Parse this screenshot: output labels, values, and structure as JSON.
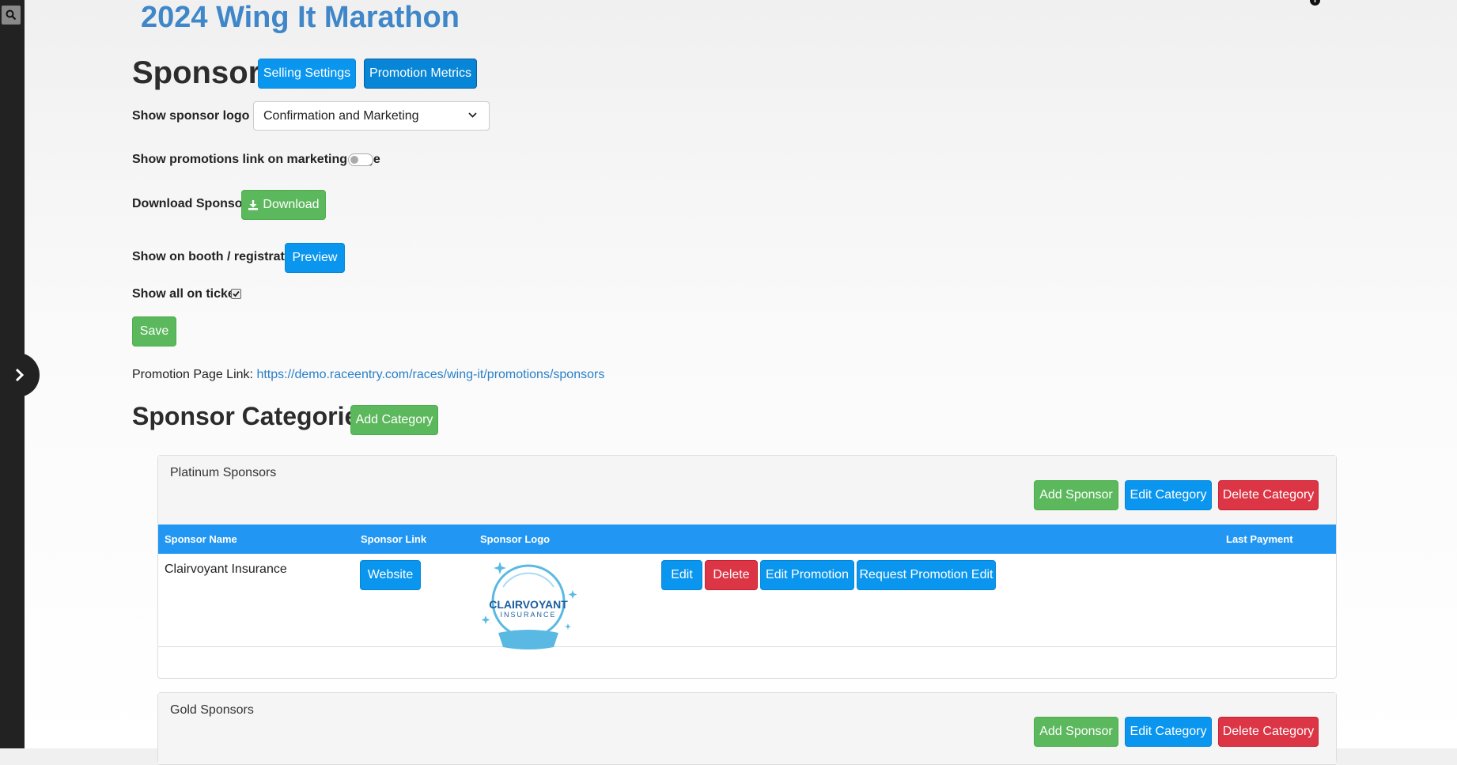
{
  "event_title": "2024 Wing It Marathon",
  "page_title": "Sponsors",
  "header_buttons": {
    "selling_settings": "Selling Settings",
    "promotion_metrics": "Promotion Metrics"
  },
  "settings": {
    "show_logo_label": "Show sponsor logo on",
    "show_logo_value": "Confirmation and Marketing",
    "show_promotions_label": "Show promotions link on marketing page",
    "show_promotions_enabled": false,
    "download_label": "Download Sponsors",
    "download_button": "Download",
    "booth_label": "Show on booth / registration",
    "preview_button": "Preview",
    "show_all_ticket_label": "Show all on ticket",
    "show_all_ticket_checked": true,
    "save_button": "Save"
  },
  "promotion_link": {
    "label": "Promotion Page Link:",
    "url": "https://demo.raceentry.com/races/wing-it/promotions/sponsors"
  },
  "categories_section": {
    "title": "Sponsor Categories",
    "add_button": "Add Category"
  },
  "category_actions": {
    "add_sponsor": "Add Sponsor",
    "edit_category": "Edit Category",
    "delete_category": "Delete Category"
  },
  "table_headers": {
    "name": "Sponsor Name",
    "link": "Sponsor Link",
    "logo": "Sponsor Logo",
    "last_payment": "Last Payment"
  },
  "categories": [
    {
      "name": "Platinum Sponsors",
      "sponsors": [
        {
          "name": "Clairvoyant Insurance",
          "link_button": "Website",
          "logo_text_main": "CLAIRVOYANT",
          "logo_text_sub": "INSURANCE",
          "last_payment": "",
          "actions": {
            "edit": "Edit",
            "delete": "Delete",
            "edit_promotion": "Edit Promotion",
            "request_edit": "Request Promotion Edit"
          }
        }
      ]
    },
    {
      "name": "Gold Sponsors",
      "sponsors": []
    }
  ],
  "colors": {
    "brand_blue": "#0a96ee",
    "title_blue": "#3f87c9",
    "success": "#5cb85c",
    "danger": "#dc3545",
    "table_head": "#2196f3"
  },
  "icons": {
    "rail_search": "search-icon",
    "rail_toggle": "chevron-right-icon",
    "info": "info-icon",
    "download": "download-icon"
  }
}
